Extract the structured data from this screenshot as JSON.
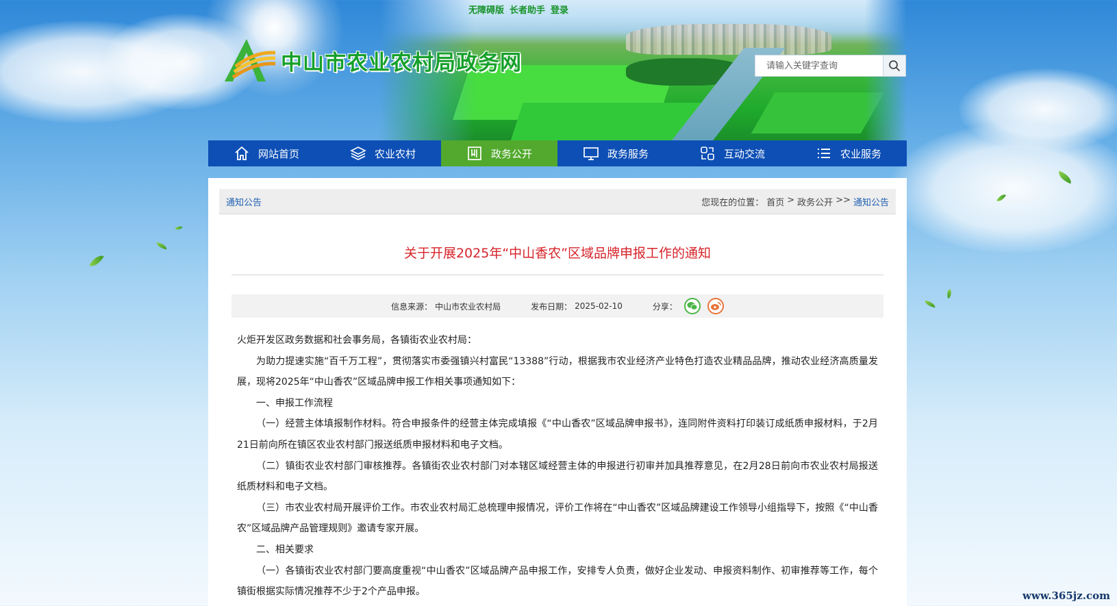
{
  "top_links": [
    "无障碍版",
    "长者助手",
    "登录"
  ],
  "site": {
    "title": "中山市农业农村局政务网"
  },
  "search": {
    "placeholder": "请输入关键字查询"
  },
  "nav": {
    "items": [
      {
        "label": "网站首页",
        "icon": "home-icon"
      },
      {
        "label": "农业农村",
        "icon": "layers-icon"
      },
      {
        "label": "政务公开",
        "icon": "book-icon"
      },
      {
        "label": "政务服务",
        "icon": "monitor-icon"
      },
      {
        "label": "互动交流",
        "icon": "exchange-icon"
      },
      {
        "label": "农业服务",
        "icon": "list-icon"
      }
    ],
    "active": "政务公开"
  },
  "breadcrumb": {
    "category": "通知公告",
    "prefix": "您现在的位置：",
    "home": "首页",
    "sep1": ">",
    "section": "政务公开",
    "sep2": ">>",
    "current": "通知公告"
  },
  "article": {
    "title": "关于开展2025年“中山香农”区域品牌申报工作的通知",
    "source_label": "信息来源：",
    "source": "中山市农业农村局",
    "date_label": "发布日期：",
    "date": "2025-02-10",
    "share_label": "分享：",
    "paragraphs": [
      "火炬开发区政务数据和社会事务局，各镇街农业农村局：",
      "为助力提速实施“百千万工程”，贯彻落实市委强镇兴村富民“13388”行动，根据我市农业经济产业特色打造农业精品品牌，推动农业经济高质量发展，现将2025年“中山香农”区域品牌申报工作相关事项通知如下：",
      "一、申报工作流程",
      "（一）经营主体填报制作材料。符合申报条件的经营主体完成填报《“中山香农”区域品牌申报书》，连同附件资料打印装订成纸质申报材料，于2月21日前向所在镇区农业农村部门报送纸质申报材料和电子文档。",
      "（二）镇街农业农村部门审核推荐。各镇街农业农村部门对本辖区域经营主体的申报进行初审并加具推荐意见，在2月28日前向市农业农村局报送纸质材料和电子文档。",
      "（三）市农业农村局开展评价工作。市农业农村局汇总梳理申报情况，评价工作将在“中山香农”区域品牌建设工作领导小组指导下，按照《“中山香农”区域品牌产品管理规则》邀请专家开展。",
      "二、相关要求",
      "（一）各镇街农业农村部门要高度重视“中山香农”区域品牌产品申报工作，安排专人负责，做好企业发动、申报资料制作、初审推荐等工作，每个镇街根据实际情况推荐不少于2个产品申报。"
    ]
  },
  "watermark": "www.365jz.com",
  "colors": {
    "nav": "#0d4fb5",
    "nav_active": "#52a92d",
    "title_red": "#d6232a",
    "brand_green": "#16a02b"
  }
}
